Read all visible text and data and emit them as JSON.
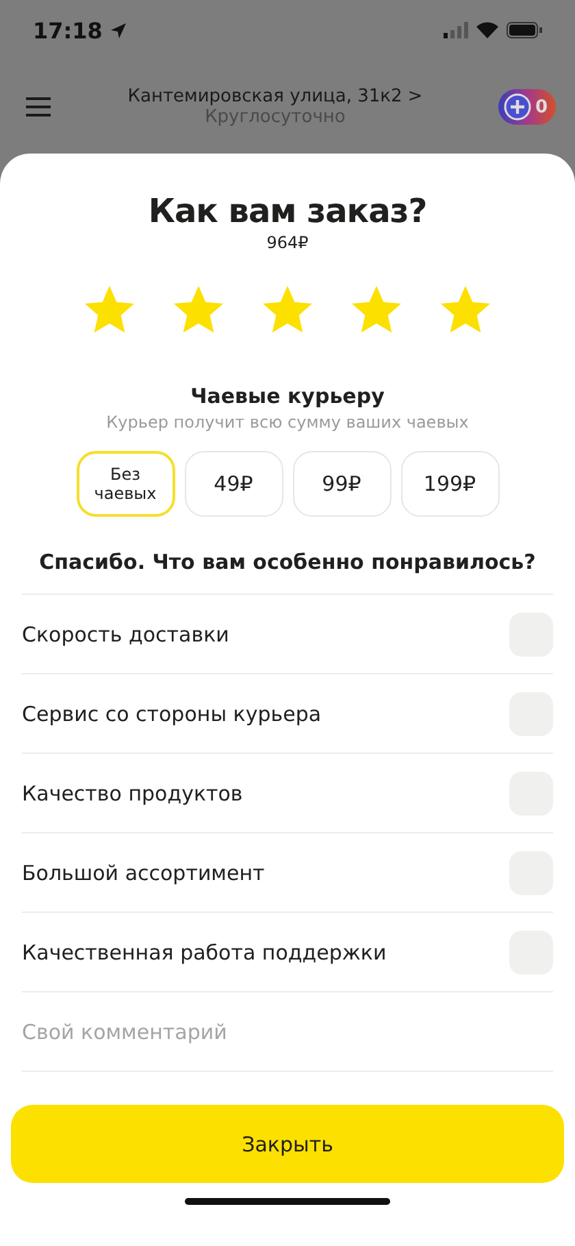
{
  "status_bar": {
    "time": "17:18"
  },
  "header": {
    "address": "Кантемировская улица, 31к2",
    "address_arrow": ">",
    "hours": "Круглосуточно",
    "plus_badge": "0"
  },
  "sheet": {
    "title": "Как вам заказ?",
    "price": "964₽",
    "stars": 5,
    "tips": {
      "title": "Чаевые курьеру",
      "subtitle": "Курьер получит всю сумму ваших чаевых",
      "options": [
        {
          "label": "Без чаевых",
          "selected": true
        },
        {
          "label": "49₽",
          "selected": false
        },
        {
          "label": "99₽",
          "selected": false
        },
        {
          "label": "199₽",
          "selected": false
        }
      ]
    },
    "question": "Спасибо. Что вам особенно понравилось?",
    "options": [
      {
        "label": "Скорость доставки",
        "checked": false
      },
      {
        "label": "Сервис со стороны курьера",
        "checked": false
      },
      {
        "label": "Качество продуктов",
        "checked": false
      },
      {
        "label": "Большой ассортимент",
        "checked": false
      },
      {
        "label": "Качественная работа поддержки",
        "checked": false
      }
    ],
    "comment": {
      "placeholder": "Свой комментарий"
    },
    "close_button": "Закрыть"
  }
}
